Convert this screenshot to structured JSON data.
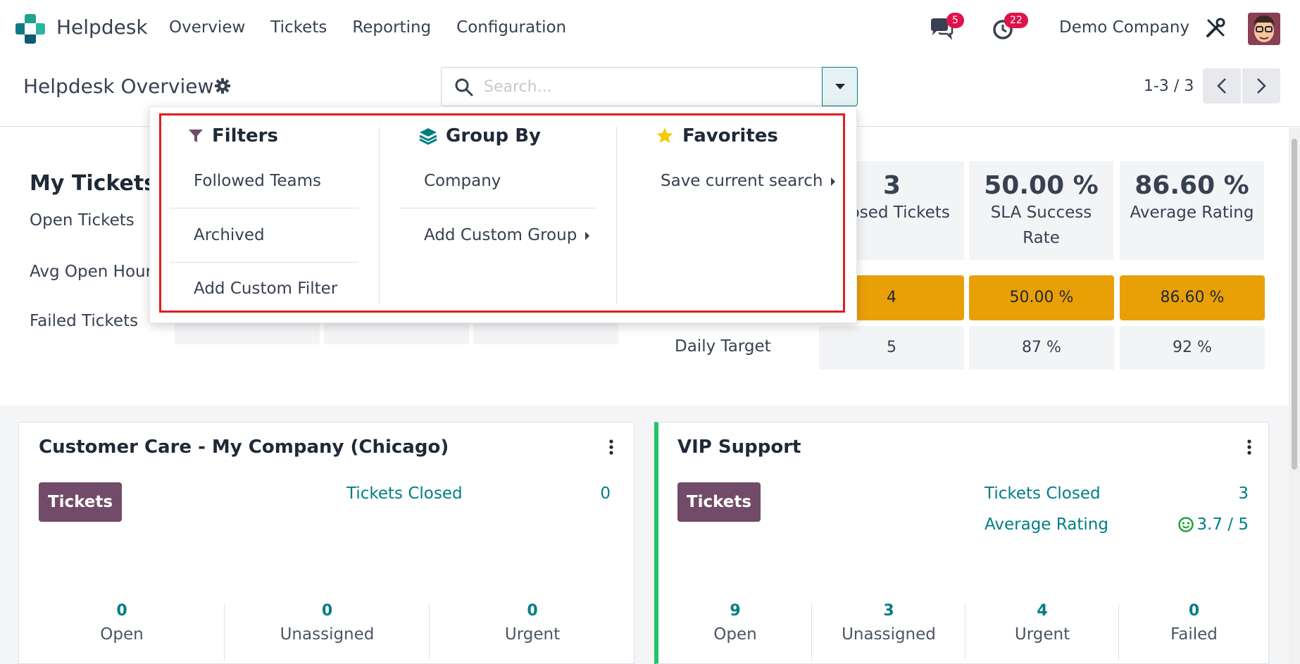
{
  "navbar": {
    "brand": "Helpdesk",
    "menu": [
      "Overview",
      "Tickets",
      "Reporting",
      "Configuration"
    ],
    "messages_badge": "5",
    "activities_badge": "22",
    "company": "Demo Company"
  },
  "control_panel": {
    "title": "Helpdesk Overview",
    "search_placeholder": "Search...",
    "pager": "1-3 / 3"
  },
  "dropdown": {
    "filters": {
      "heading": "Filters",
      "items": [
        "Followed Teams",
        "Archived",
        "Add Custom Filter"
      ]
    },
    "group_by": {
      "heading": "Group By",
      "items": [
        "Company",
        "Add Custom Group"
      ]
    },
    "favorites": {
      "heading": "Favorites",
      "items": [
        "Save current search"
      ]
    }
  },
  "my_tickets": {
    "title": "My Tickets",
    "rows": [
      "Open Tickets",
      "Avg Open Hours",
      "Failed Tickets"
    ]
  },
  "performance": {
    "stats": [
      {
        "value": "3",
        "label": "Closed Tickets"
      },
      {
        "value": "50.00 %",
        "label": "SLA Success Rate"
      },
      {
        "value": "86.60 %",
        "label": "Average Rating"
      }
    ],
    "actual": [
      "4",
      "50.00 %",
      "86.60 %"
    ],
    "daily_target_label": "Daily Target",
    "daily_target": [
      "5",
      "87 %",
      "92 %"
    ]
  },
  "teams": [
    {
      "name": "Customer Care - My Company (Chicago)",
      "button": "Tickets",
      "links": [
        {
          "label": "Tickets Closed",
          "value": "0"
        }
      ],
      "counts": [
        {
          "value": "0",
          "label": "Open"
        },
        {
          "value": "0",
          "label": "Unassigned"
        },
        {
          "value": "0",
          "label": "Urgent"
        }
      ]
    },
    {
      "name": "VIP Support",
      "button": "Tickets",
      "links": [
        {
          "label": "Tickets Closed",
          "value": "3"
        },
        {
          "label": "Average Rating",
          "value": "3.7 / 5"
        }
      ],
      "counts": [
        {
          "value": "9",
          "label": "Open"
        },
        {
          "value": "3",
          "label": "Unassigned"
        },
        {
          "value": "4",
          "label": "Urgent"
        },
        {
          "value": "0",
          "label": "Failed"
        }
      ]
    }
  ],
  "colors": {
    "primary": "#714b67",
    "accent_teal": "#017e84",
    "performance_bar": "#e9a006",
    "highlight_frame": "#e11d1d",
    "badge": "#e0124b"
  }
}
